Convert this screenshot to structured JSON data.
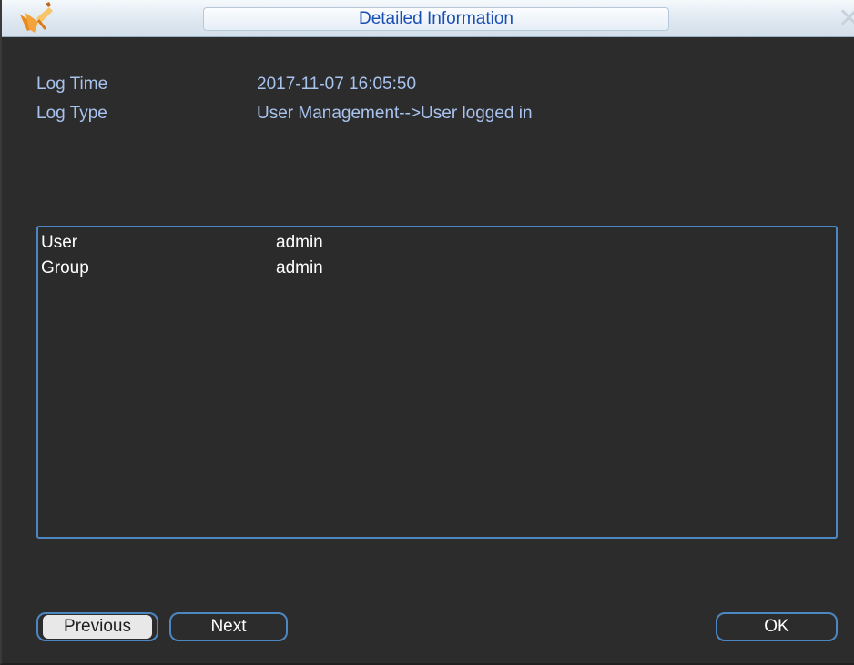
{
  "window": {
    "title": "Detailed Information",
    "logo_icon": "pencil-check-logo-icon",
    "close_icon": "close-icon",
    "close_glyph": "✕"
  },
  "info": {
    "log_time_label": "Log Time",
    "log_time_value": "2017-11-07 16:05:50",
    "log_type_label": "Log Type",
    "log_type_value": "User Management-->User logged in"
  },
  "details": [
    {
      "key": "User",
      "value": "admin"
    },
    {
      "key": "Group",
      "value": "admin"
    }
  ],
  "buttons": {
    "previous": "Previous",
    "next": "Next",
    "ok": "OK"
  },
  "colors": {
    "title_text": "#1a4fb3",
    "label_text": "#a9c3ef",
    "accent_border": "#4d87c2",
    "background": "#2c2c2c"
  }
}
